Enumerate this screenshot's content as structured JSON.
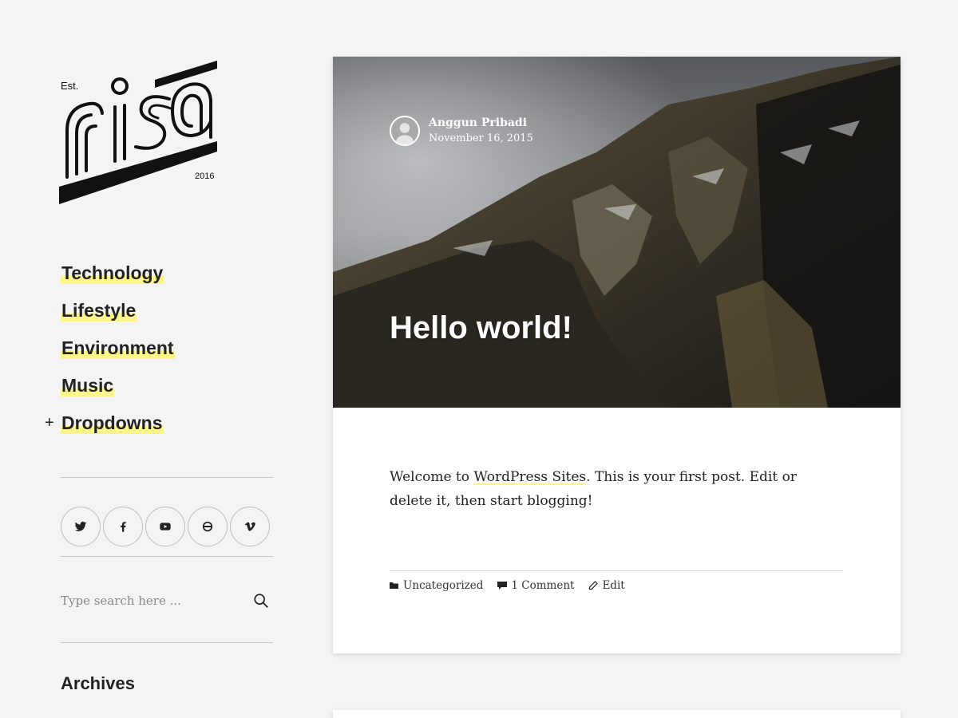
{
  "logo": {
    "est": "Est.",
    "name": "risa",
    "year": "2016"
  },
  "nav": {
    "items": [
      {
        "label": "Technology"
      },
      {
        "label": "Lifestyle"
      },
      {
        "label": "Environment"
      },
      {
        "label": "Music"
      },
      {
        "label": "Dropdowns",
        "expand": "+"
      }
    ]
  },
  "social": [
    "twitter-icon",
    "facebook-icon",
    "youtube-icon",
    "flickr-icon",
    "vimeo-icon"
  ],
  "search": {
    "placeholder": "Type search here ..."
  },
  "widgets": {
    "archives_title": "Archives"
  },
  "post": {
    "author": "Anggun Pribadi",
    "date": "November 16, 2015",
    "title": "Hello world!",
    "content_before": "Welcome to ",
    "content_link": "WordPress Sites",
    "content_after": ". This is your first post. Edit or delete it, then start blogging!",
    "category": "Uncategorized",
    "comments": "1 Comment",
    "edit": "Edit"
  },
  "colors": {
    "highlight": "#fcf58c",
    "background": "#f4f4f4",
    "text": "#1a1a1a"
  }
}
